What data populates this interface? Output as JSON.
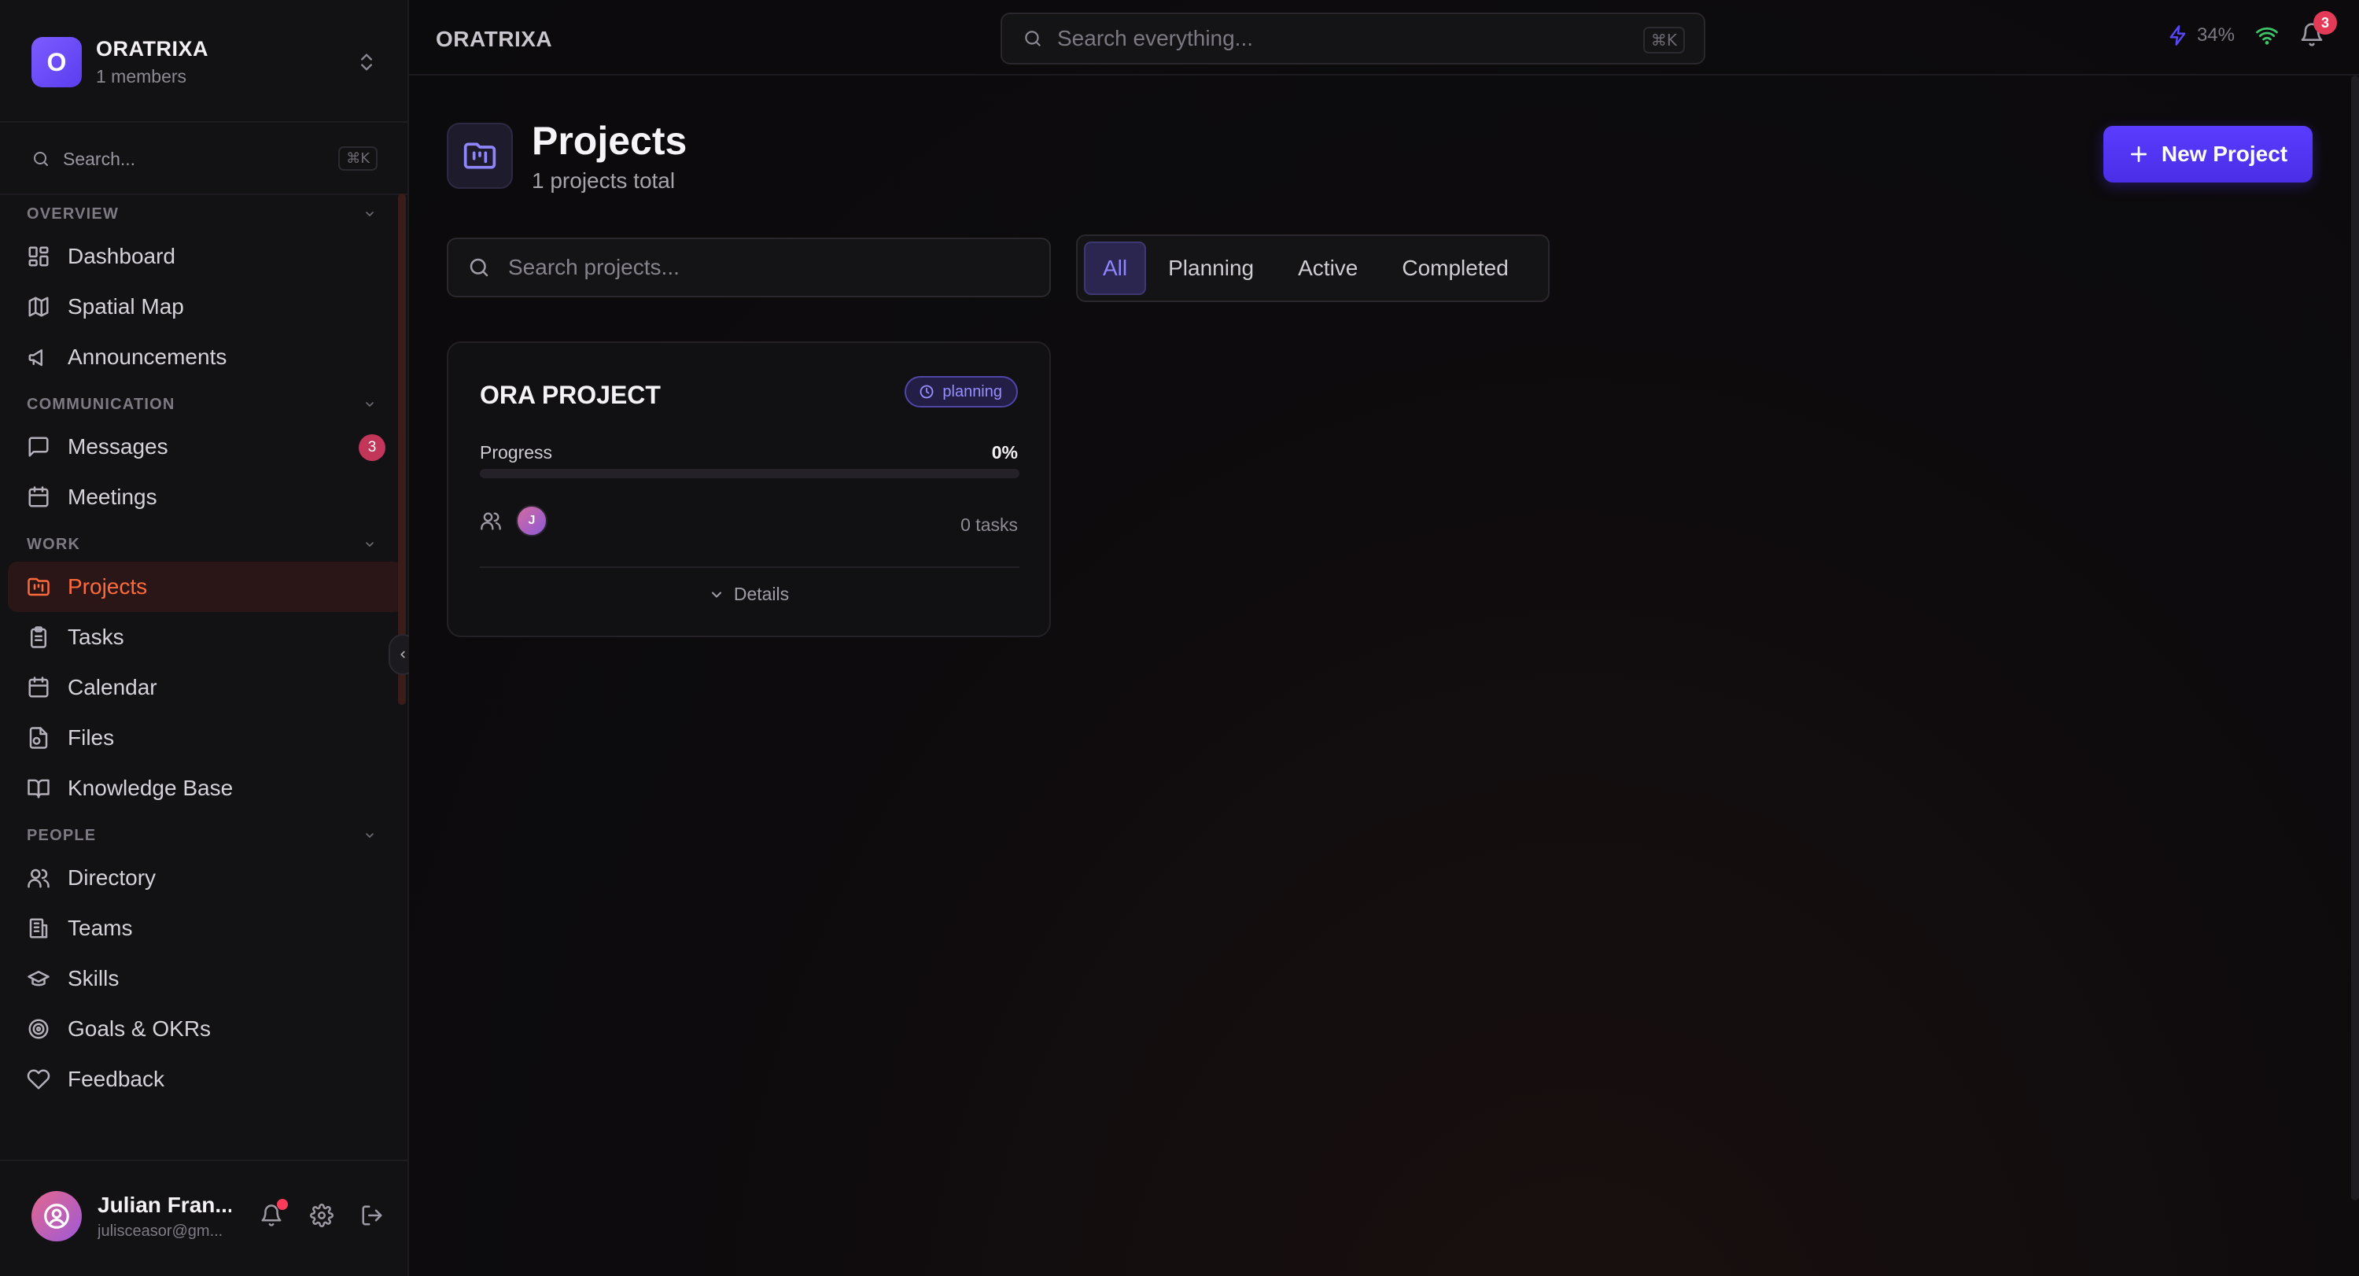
{
  "workspace": {
    "initial": "O",
    "name": "ORATRIXA",
    "members": "1 members"
  },
  "sidebar": {
    "search_label": "Search...",
    "shortcut": "⌘K",
    "sections": [
      {
        "label": "OVERVIEW",
        "items": [
          {
            "label": "Dashboard",
            "icon": "dashboard-icon"
          },
          {
            "label": "Spatial Map",
            "icon": "map-icon"
          },
          {
            "label": "Announcements",
            "icon": "megaphone-icon"
          }
        ]
      },
      {
        "label": "COMMUNICATION",
        "items": [
          {
            "label": "Messages",
            "icon": "message-icon",
            "badge": "3"
          },
          {
            "label": "Meetings",
            "icon": "calendar-icon"
          }
        ]
      },
      {
        "label": "WORK",
        "items": [
          {
            "label": "Projects",
            "icon": "folder-kanban-icon",
            "active": true
          },
          {
            "label": "Tasks",
            "icon": "clipboard-icon"
          },
          {
            "label": "Calendar",
            "icon": "calendar-icon"
          },
          {
            "label": "Files",
            "icon": "file-icon"
          },
          {
            "label": "Knowledge Base",
            "icon": "book-icon"
          }
        ]
      },
      {
        "label": "PEOPLE",
        "items": [
          {
            "label": "Directory",
            "icon": "users-icon"
          },
          {
            "label": "Teams",
            "icon": "building-icon"
          },
          {
            "label": "Skills",
            "icon": "graduation-cap-icon"
          },
          {
            "label": "Goals & OKRs",
            "icon": "target-icon"
          },
          {
            "label": "Feedback",
            "icon": "heart-icon"
          }
        ]
      }
    ]
  },
  "user": {
    "name": "Julian Fran...",
    "email": "julisceasor@gm..."
  },
  "topbar": {
    "app_title": "ORATRIXA",
    "search_placeholder": "Search everything...",
    "shortcut": "⌘K",
    "battery": "34%",
    "notification_count": "3"
  },
  "page": {
    "title": "Projects",
    "subtitle": "1 projects total",
    "new_button": "New Project",
    "search_placeholder": "Search projects...",
    "filters": [
      {
        "label": "All",
        "active": true
      },
      {
        "label": "Planning",
        "active": false
      },
      {
        "label": "Active",
        "active": false
      },
      {
        "label": "Completed",
        "active": false
      }
    ]
  },
  "projects": [
    {
      "name": "ORA PROJECT",
      "status": "planning",
      "progress_label": "Progress",
      "progress": "0%",
      "progress_value": 0,
      "member_initial": "J",
      "tasks": "0 tasks",
      "details_label": "Details"
    }
  ],
  "colors": {
    "accent": "#5a3cff",
    "active_nav": "#ff6a3d",
    "badge": "#e23a57"
  }
}
